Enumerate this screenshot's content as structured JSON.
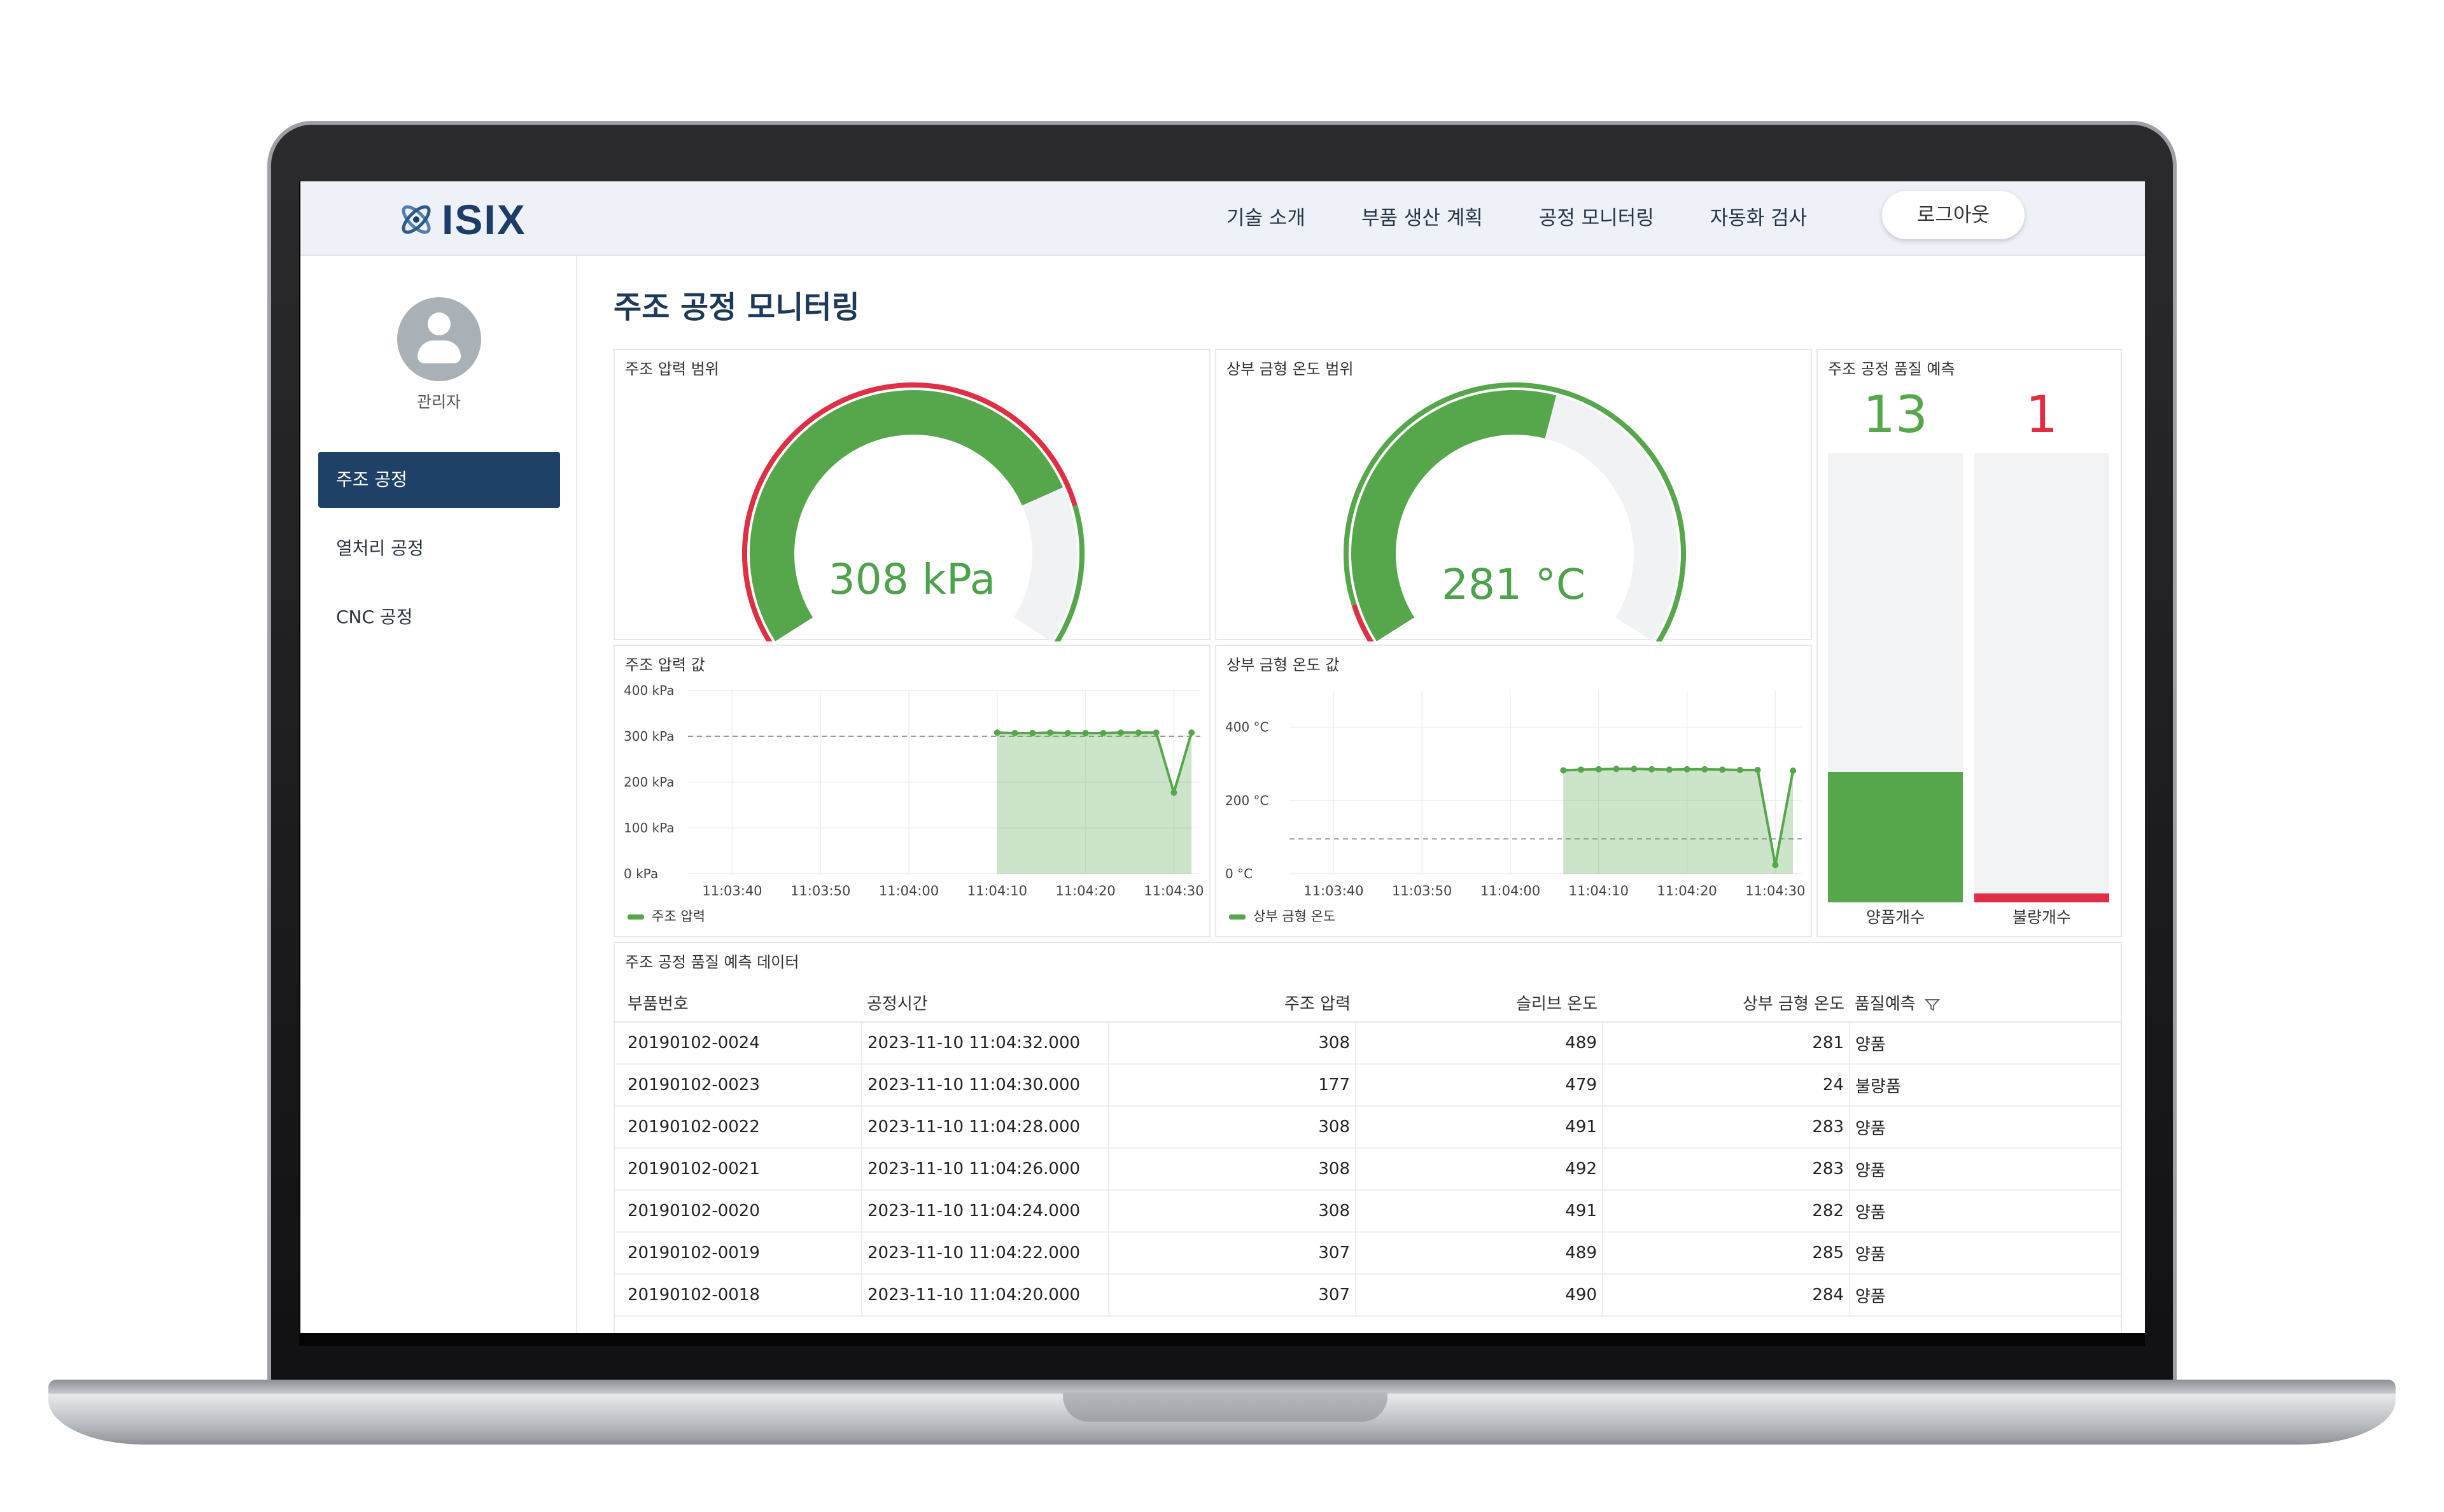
{
  "brand": {
    "name": "ISIX"
  },
  "nav": {
    "items": [
      "기술 소개",
      "부품 생산 계획",
      "공정 모니터링",
      "자동화 검사"
    ],
    "logout": "로그아웃"
  },
  "sidebar": {
    "user": "관리자",
    "items": [
      {
        "label": "주조 공정",
        "active": true
      },
      {
        "label": "열처리 공정",
        "active": false
      },
      {
        "label": "CNC 공정",
        "active": false
      }
    ]
  },
  "page_title": "주조 공정 모니터링",
  "gauges": {
    "pressure": {
      "title": "주조 압력 범위",
      "value_text": "308 kPa",
      "fraction": 0.77
    },
    "temperature": {
      "title": "상부 금형 온도 범위",
      "value_text": "281 °C",
      "fraction": 0.56
    }
  },
  "quality": {
    "title": "주조 공정 품질 예측",
    "good": {
      "count": "13",
      "label": "양품개수",
      "fraction": 0.29
    },
    "bad": {
      "count": "1",
      "label": "불량개수",
      "fraction": 0.02
    },
    "colors": {
      "good": "#56a64b",
      "bad": "#e02f44"
    }
  },
  "chart_data": [
    {
      "type": "area",
      "title": "주조 압력 값",
      "y_ticks": [
        "400 kPa",
        "300 kPa",
        "200 kPa",
        "100 kPa",
        "0 kPa"
      ],
      "x_ticks": [
        "11:03:40",
        "11:03:50",
        "11:04:00",
        "11:04:10",
        "11:04:20",
        "11:04:30"
      ],
      "x_range": [
        "11:03:35",
        "11:04:33"
      ],
      "ylim": [
        0,
        400
      ],
      "threshold": 300,
      "series": [
        {
          "name": "주조 압력",
          "x": [
            "11:04:10",
            "11:04:12",
            "11:04:14",
            "11:04:16",
            "11:04:18",
            "11:04:20",
            "11:04:22",
            "11:04:24",
            "11:04:26",
            "11:04:28",
            "11:04:30",
            "11:04:32"
          ],
          "values": [
            308,
            307,
            307,
            308,
            307,
            307,
            307,
            308,
            308,
            308,
            177,
            308
          ]
        }
      ],
      "legend": "bottom-left"
    },
    {
      "type": "area",
      "title": "상부 금형 온도 값",
      "y_ticks": [
        "400 °C",
        "200 °C",
        "0 °C"
      ],
      "x_ticks": [
        "11:03:40",
        "11:03:50",
        "11:04:00",
        "11:04:10",
        "11:04:20",
        "11:04:30"
      ],
      "x_range": [
        "11:03:35",
        "11:04:33"
      ],
      "ylim": [
        0,
        500
      ],
      "threshold": 95,
      "series": [
        {
          "name": "상부 금형 온도",
          "x": [
            "11:04:06",
            "11:04:08",
            "11:04:10",
            "11:04:12",
            "11:04:14",
            "11:04:16",
            "11:04:18",
            "11:04:20",
            "11:04:22",
            "11:04:24",
            "11:04:26",
            "11:04:28",
            "11:04:30",
            "11:04:32"
          ],
          "values": [
            282,
            284,
            285,
            286,
            286,
            285,
            284,
            285,
            285,
            284,
            283,
            283,
            24,
            281
          ]
        }
      ],
      "legend": "bottom-left"
    }
  ],
  "table": {
    "title": "주조 공정 품질 예측 데이터",
    "headers": [
      "부품번호",
      "공정시간",
      "주조 압력",
      "슬리브 온도",
      "상부 금형 온도",
      "품질예측"
    ],
    "rows": [
      [
        "20190102-0024",
        "2023-11-10 11:04:32.000",
        "308",
        "489",
        "281",
        "양품"
      ],
      [
        "20190102-0023",
        "2023-11-10 11:04:30.000",
        "177",
        "479",
        "24",
        "불량품"
      ],
      [
        "20190102-0022",
        "2023-11-10 11:04:28.000",
        "308",
        "491",
        "283",
        "양품"
      ],
      [
        "20190102-0021",
        "2023-11-10 11:04:26.000",
        "308",
        "492",
        "283",
        "양품"
      ],
      [
        "20190102-0020",
        "2023-11-10 11:04:24.000",
        "308",
        "491",
        "282",
        "양품"
      ],
      [
        "20190102-0019",
        "2023-11-10 11:04:22.000",
        "307",
        "489",
        "285",
        "양품"
      ],
      [
        "20190102-0018",
        "2023-11-10 11:04:20.000",
        "307",
        "490",
        "284",
        "양품"
      ]
    ]
  }
}
